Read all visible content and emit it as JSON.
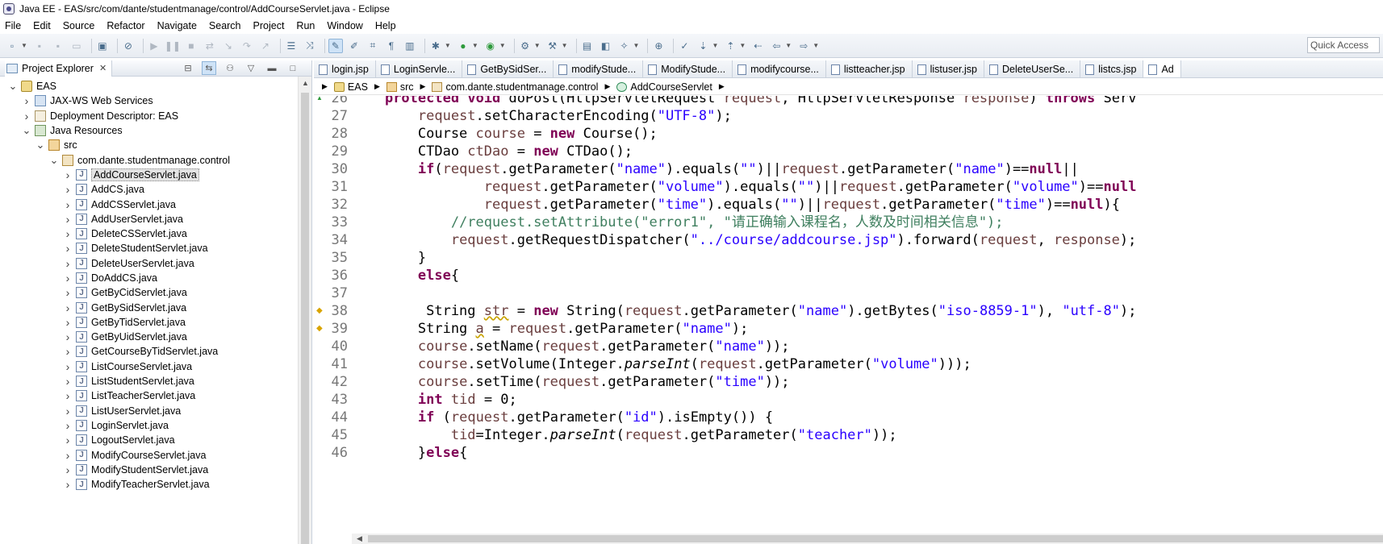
{
  "window": {
    "title": "Java EE - EAS/src/com/dante/studentmanage/control/AddCourseServlet.java - Eclipse"
  },
  "menu": [
    "File",
    "Edit",
    "Source",
    "Refactor",
    "Navigate",
    "Search",
    "Project",
    "Run",
    "Window",
    "Help"
  ],
  "quick_access": {
    "placeholder": "Quick Access"
  },
  "project_explorer": {
    "title": "Project Explorer",
    "close_glyph": "✕",
    "tree": [
      {
        "label": "EAS",
        "icon": "project-icon",
        "depth": 0,
        "twisty": "open"
      },
      {
        "label": "JAX-WS Web Services",
        "icon": "web-services-icon",
        "depth": 1,
        "twisty": "closed"
      },
      {
        "label": "Deployment Descriptor: EAS",
        "icon": "deployment-descriptor-icon",
        "depth": 1,
        "twisty": "closed"
      },
      {
        "label": "Java Resources",
        "icon": "java-resources-icon",
        "depth": 1,
        "twisty": "open"
      },
      {
        "label": "src",
        "icon": "source-folder-icon",
        "depth": 2,
        "twisty": "open"
      },
      {
        "label": "com.dante.studentmanage.control",
        "icon": "package-icon",
        "depth": 3,
        "twisty": "open"
      },
      {
        "label": "AddCourseServlet.java",
        "icon": "java-file-icon",
        "depth": 4,
        "twisty": "closed",
        "selected": true
      },
      {
        "label": "AddCS.java",
        "icon": "java-file-icon",
        "depth": 4,
        "twisty": "closed"
      },
      {
        "label": "AddCSServlet.java",
        "icon": "java-file-icon",
        "depth": 4,
        "twisty": "closed"
      },
      {
        "label": "AddUserServlet.java",
        "icon": "java-file-icon",
        "depth": 4,
        "twisty": "closed"
      },
      {
        "label": "DeleteCSServlet.java",
        "icon": "java-file-icon",
        "depth": 4,
        "twisty": "closed"
      },
      {
        "label": "DeleteStudentServlet.java",
        "icon": "java-file-icon",
        "depth": 4,
        "twisty": "closed"
      },
      {
        "label": "DeleteUserServlet.java",
        "icon": "java-file-icon",
        "depth": 4,
        "twisty": "closed"
      },
      {
        "label": "DoAddCS.java",
        "icon": "java-file-icon",
        "depth": 4,
        "twisty": "closed"
      },
      {
        "label": "GetByCidServlet.java",
        "icon": "java-file-icon",
        "depth": 4,
        "twisty": "closed"
      },
      {
        "label": "GetBySidServlet.java",
        "icon": "java-file-icon",
        "depth": 4,
        "twisty": "closed"
      },
      {
        "label": "GetByTidServlet.java",
        "icon": "java-file-icon",
        "depth": 4,
        "twisty": "closed"
      },
      {
        "label": "GetByUidServlet.java",
        "icon": "java-file-icon",
        "depth": 4,
        "twisty": "closed"
      },
      {
        "label": "GetCourseByTidServlet.java",
        "icon": "java-file-icon",
        "depth": 4,
        "twisty": "closed"
      },
      {
        "label": "ListCourseServlet.java",
        "icon": "java-file-icon",
        "depth": 4,
        "twisty": "closed"
      },
      {
        "label": "ListStudentServlet.java",
        "icon": "java-file-icon",
        "depth": 4,
        "twisty": "closed"
      },
      {
        "label": "ListTeacherServlet.java",
        "icon": "java-file-icon",
        "depth": 4,
        "twisty": "closed"
      },
      {
        "label": "ListUserServlet.java",
        "icon": "java-file-icon",
        "depth": 4,
        "twisty": "closed"
      },
      {
        "label": "LoginServlet.java",
        "icon": "java-file-icon",
        "depth": 4,
        "twisty": "closed"
      },
      {
        "label": "LogoutServlet.java",
        "icon": "java-file-icon",
        "depth": 4,
        "twisty": "closed"
      },
      {
        "label": "ModifyCourseServlet.java",
        "icon": "java-file-icon",
        "depth": 4,
        "twisty": "closed"
      },
      {
        "label": "ModifyStudentServlet.java",
        "icon": "java-file-icon",
        "depth": 4,
        "twisty": "closed"
      },
      {
        "label": "ModifyTeacherServlet.java",
        "icon": "java-file-icon",
        "depth": 4,
        "twisty": "closed"
      }
    ]
  },
  "editor": {
    "tabs": [
      "login.jsp",
      "LoginServle...",
      "GetBySidSer...",
      "modifyStude...",
      "ModifyStude...",
      "modifycourse...",
      "listteacher.jsp",
      "listuser.jsp",
      "DeleteUserSe...",
      "listcs.jsp",
      "Ad"
    ],
    "active_tab_index": 10,
    "breadcrumb": [
      "EAS",
      "src",
      "com.dante.studentmanage.control",
      "AddCourseServlet"
    ],
    "lines": [
      {
        "num": "26",
        "marker": "override",
        "tokens": [
          [
            "p",
            "    "
          ],
          [
            "kw",
            "protected"
          ],
          [
            "p",
            " "
          ],
          [
            "kw",
            "void"
          ],
          [
            "p",
            " doPost(HttpServletRequest "
          ],
          [
            "var",
            "request"
          ],
          [
            "p",
            ", HttpServletResponse "
          ],
          [
            "var",
            "response"
          ],
          [
            "p",
            ") "
          ],
          [
            "kw",
            "throws"
          ],
          [
            "p",
            " Serv"
          ]
        ]
      },
      {
        "num": "27",
        "tokens": [
          [
            "p",
            "        "
          ],
          [
            "var",
            "request"
          ],
          [
            "p",
            ".setCharacterEncoding("
          ],
          [
            "str",
            "\"UTF-8\""
          ],
          [
            "p",
            ");"
          ]
        ]
      },
      {
        "num": "28",
        "tokens": [
          [
            "p",
            "        Course "
          ],
          [
            "var",
            "course"
          ],
          [
            "p",
            " = "
          ],
          [
            "kw",
            "new"
          ],
          [
            "p",
            " Course();"
          ]
        ]
      },
      {
        "num": "29",
        "tokens": [
          [
            "p",
            "        CTDao "
          ],
          [
            "var",
            "ctDao"
          ],
          [
            "p",
            " = "
          ],
          [
            "kw",
            "new"
          ],
          [
            "p",
            " CTDao();"
          ]
        ]
      },
      {
        "num": "30",
        "tokens": [
          [
            "p",
            "        "
          ],
          [
            "kw",
            "if"
          ],
          [
            "p",
            "("
          ],
          [
            "var",
            "request"
          ],
          [
            "p",
            ".getParameter("
          ],
          [
            "str",
            "\"name\""
          ],
          [
            "p",
            ").equals("
          ],
          [
            "str",
            "\"\""
          ],
          [
            "p",
            ")||"
          ],
          [
            "var",
            "request"
          ],
          [
            "p",
            ".getParameter("
          ],
          [
            "str",
            "\"name\""
          ],
          [
            "p",
            ")=="
          ],
          [
            "kw",
            "null"
          ],
          [
            "p",
            "||"
          ]
        ]
      },
      {
        "num": "31",
        "tokens": [
          [
            "p",
            "                "
          ],
          [
            "var",
            "request"
          ],
          [
            "p",
            ".getParameter("
          ],
          [
            "str",
            "\"volume\""
          ],
          [
            "p",
            ").equals("
          ],
          [
            "str",
            "\"\""
          ],
          [
            "p",
            ")||"
          ],
          [
            "var",
            "request"
          ],
          [
            "p",
            ".getParameter("
          ],
          [
            "str",
            "\"volume\""
          ],
          [
            "p",
            ")=="
          ],
          [
            "kw",
            "null"
          ]
        ]
      },
      {
        "num": "32",
        "tokens": [
          [
            "p",
            "                "
          ],
          [
            "var",
            "request"
          ],
          [
            "p",
            ".getParameter("
          ],
          [
            "str",
            "\"time\""
          ],
          [
            "p",
            ").equals("
          ],
          [
            "str",
            "\"\""
          ],
          [
            "p",
            ")||"
          ],
          [
            "var",
            "request"
          ],
          [
            "p",
            ".getParameter("
          ],
          [
            "str",
            "\"time\""
          ],
          [
            "p",
            ")=="
          ],
          [
            "kw",
            "null"
          ],
          [
            "p",
            "){"
          ]
        ]
      },
      {
        "num": "33",
        "tokens": [
          [
            "p",
            "            "
          ],
          [
            "com",
            "//request.setAttribute(\"error1\", \"请正确输入课程名，人数及时间相关信息\");"
          ]
        ]
      },
      {
        "num": "34",
        "tokens": [
          [
            "p",
            "            "
          ],
          [
            "var",
            "request"
          ],
          [
            "p",
            ".getRequestDispatcher("
          ],
          [
            "str",
            "\"../course/addcourse.jsp\""
          ],
          [
            "p",
            ").forward("
          ],
          [
            "var",
            "request"
          ],
          [
            "p",
            ", "
          ],
          [
            "var",
            "response"
          ],
          [
            "p",
            ");"
          ]
        ]
      },
      {
        "num": "35",
        "tokens": [
          [
            "p",
            "        }"
          ]
        ]
      },
      {
        "num": "36",
        "tokens": [
          [
            "p",
            "        "
          ],
          [
            "kw",
            "else"
          ],
          [
            "p",
            "{"
          ]
        ]
      },
      {
        "num": "37",
        "tokens": [
          [
            "p",
            ""
          ]
        ]
      },
      {
        "num": "38",
        "marker": "warning",
        "tokens": [
          [
            "p",
            "         String "
          ],
          [
            "warn",
            "str"
          ],
          [
            "p",
            " = "
          ],
          [
            "kw",
            "new"
          ],
          [
            "p",
            " String("
          ],
          [
            "var",
            "request"
          ],
          [
            "p",
            ".getParameter("
          ],
          [
            "str",
            "\"name\""
          ],
          [
            "p",
            ").getBytes("
          ],
          [
            "str",
            "\"iso-8859-1\""
          ],
          [
            "p",
            "), "
          ],
          [
            "str",
            "\"utf-8\""
          ],
          [
            "p",
            ");"
          ]
        ]
      },
      {
        "num": "39",
        "marker": "warning",
        "tokens": [
          [
            "p",
            "        String "
          ],
          [
            "warn",
            "a"
          ],
          [
            "p",
            " = "
          ],
          [
            "var",
            "request"
          ],
          [
            "p",
            ".getParameter("
          ],
          [
            "str",
            "\"name\""
          ],
          [
            "p",
            ");"
          ]
        ]
      },
      {
        "num": "40",
        "tokens": [
          [
            "p",
            "        "
          ],
          [
            "var",
            "course"
          ],
          [
            "p",
            ".setName("
          ],
          [
            "var",
            "request"
          ],
          [
            "p",
            ".getParameter("
          ],
          [
            "str",
            "\"name\""
          ],
          [
            "p",
            "));"
          ]
        ]
      },
      {
        "num": "41",
        "tokens": [
          [
            "p",
            "        "
          ],
          [
            "var",
            "course"
          ],
          [
            "p",
            ".setVolume(Integer."
          ],
          [
            "it",
            "parseInt"
          ],
          [
            "p",
            "("
          ],
          [
            "var",
            "request"
          ],
          [
            "p",
            ".getParameter("
          ],
          [
            "str",
            "\"volume\""
          ],
          [
            "p",
            ")));"
          ]
        ]
      },
      {
        "num": "42",
        "tokens": [
          [
            "p",
            "        "
          ],
          [
            "var",
            "course"
          ],
          [
            "p",
            ".setTime("
          ],
          [
            "var",
            "request"
          ],
          [
            "p",
            ".getParameter("
          ],
          [
            "str",
            "\"time\""
          ],
          [
            "p",
            "));"
          ]
        ]
      },
      {
        "num": "43",
        "tokens": [
          [
            "p",
            "        "
          ],
          [
            "kw",
            "int"
          ],
          [
            "p",
            " "
          ],
          [
            "var",
            "tid"
          ],
          [
            "p",
            " = 0;"
          ]
        ]
      },
      {
        "num": "44",
        "tokens": [
          [
            "p",
            "        "
          ],
          [
            "kw",
            "if"
          ],
          [
            "p",
            " ("
          ],
          [
            "var",
            "request"
          ],
          [
            "p",
            ".getParameter("
          ],
          [
            "str",
            "\"id\""
          ],
          [
            "p",
            ").isEmpty()) {"
          ]
        ]
      },
      {
        "num": "45",
        "tokens": [
          [
            "p",
            "            "
          ],
          [
            "var",
            "tid"
          ],
          [
            "p",
            "=Integer."
          ],
          [
            "it",
            "parseInt"
          ],
          [
            "p",
            "("
          ],
          [
            "var",
            "request"
          ],
          [
            "p",
            ".getParameter("
          ],
          [
            "str",
            "\"teacher\""
          ],
          [
            "p",
            "));"
          ]
        ]
      },
      {
        "num": "46",
        "tokens": [
          [
            "p",
            "        }"
          ],
          [
            "kw",
            "else"
          ],
          [
            "p",
            "{"
          ]
        ]
      }
    ]
  },
  "colors": {
    "keyword": "#7f0055",
    "string": "#2a00ff",
    "variable": "#6a3e3e",
    "comment": "#3f7f5f",
    "line_number": "#787878"
  }
}
